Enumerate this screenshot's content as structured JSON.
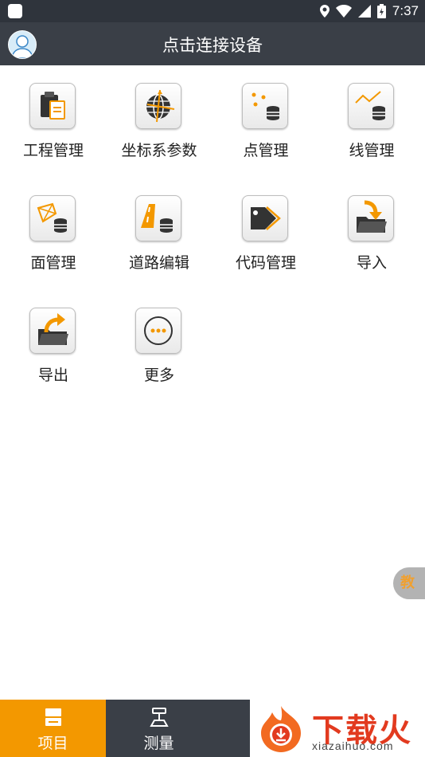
{
  "status_bar": {
    "time": "7:37",
    "icons": [
      "location-icon",
      "wifi-icon",
      "signal-icon",
      "battery-icon"
    ]
  },
  "header": {
    "title": "点击连接设备",
    "avatar_icon": "user-avatar-icon"
  },
  "grid": {
    "items": [
      {
        "label": "工程管理",
        "icon": "project-clipboard-icon"
      },
      {
        "label": "坐标系参数",
        "icon": "globe-coordinate-icon"
      },
      {
        "label": "点管理",
        "icon": "points-database-icon"
      },
      {
        "label": "线管理",
        "icon": "line-database-icon"
      },
      {
        "label": "面管理",
        "icon": "polygon-database-icon"
      },
      {
        "label": "道路编辑",
        "icon": "road-database-icon"
      },
      {
        "label": "代码管理",
        "icon": "code-tag-icon"
      },
      {
        "label": "导入",
        "icon": "import-folder-icon"
      },
      {
        "label": "导出",
        "icon": "export-folder-icon"
      },
      {
        "label": "更多",
        "icon": "more-icon"
      }
    ]
  },
  "side_tab": {
    "label": "教"
  },
  "bottom_nav": {
    "items": [
      {
        "label": "项目",
        "icon": "project-icon",
        "active": true
      },
      {
        "label": "测量",
        "icon": "measure-icon",
        "active": false
      }
    ]
  },
  "watermark": {
    "text": "下载火",
    "url": "xiazaihuo.com"
  },
  "colors": {
    "accent": "#f39800",
    "bar": "#3a3f47",
    "status": "#2f343c"
  }
}
